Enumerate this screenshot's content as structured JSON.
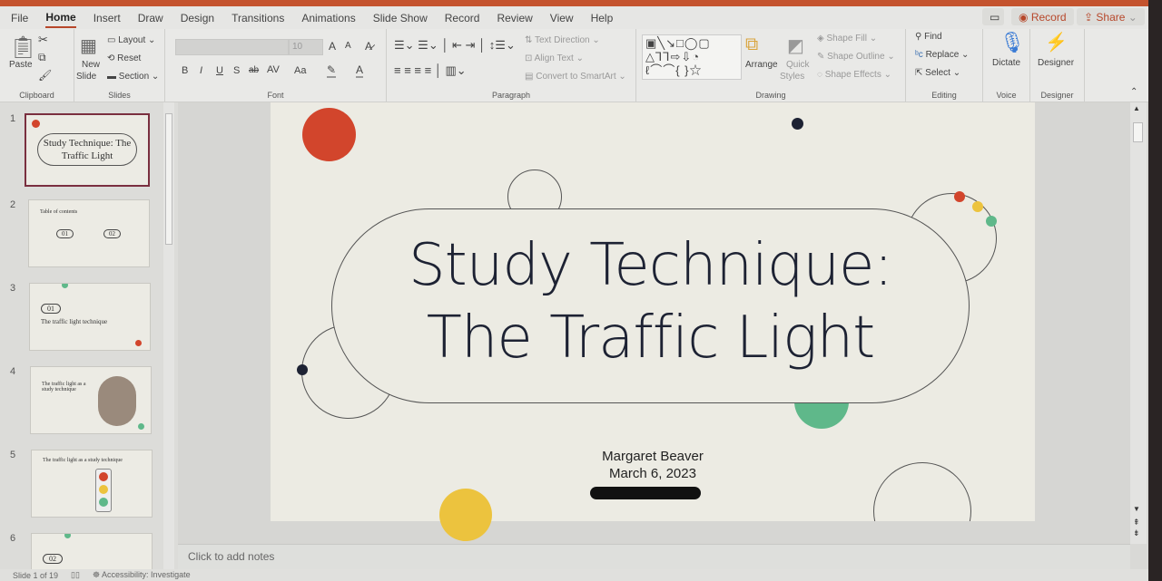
{
  "tabs": [
    "File",
    "Home",
    "Insert",
    "Draw",
    "Design",
    "Transitions",
    "Animations",
    "Slide Show",
    "Record",
    "Review",
    "View",
    "Help"
  ],
  "active_tab": "Home",
  "top_right": {
    "record": "Record",
    "share": "Share"
  },
  "ribbon": {
    "clipboard": {
      "label": "Clipboard",
      "paste": "Paste"
    },
    "slides": {
      "label": "Slides",
      "new_slide": "New",
      "new_slide2": "Slide",
      "layout": "Layout",
      "reset": "Reset",
      "section": "Section"
    },
    "font": {
      "label": "Font",
      "size": "10",
      "bold": "B",
      "italic": "I",
      "underline": "U",
      "shadow": "S",
      "strike": "ab",
      "spacing": "AV",
      "case": "Aa",
      "grow": "A",
      "shrink": "A"
    },
    "paragraph": {
      "label": "Paragraph",
      "text_direction": "Text Direction",
      "align_text": "Align Text",
      "smartart": "Convert to SmartArt"
    },
    "drawing": {
      "label": "Drawing",
      "arrange": "Arrange",
      "quick_styles": "Quick",
      "quick_styles2": "Styles",
      "shape_fill": "Shape Fill",
      "shape_outline": "Shape Outline",
      "shape_effects": "Shape Effects"
    },
    "editing": {
      "label": "Editing",
      "find": "Find",
      "replace": "Replace",
      "select": "Select"
    },
    "voice": {
      "label": "Voice",
      "dictate": "Dictate"
    },
    "designer": {
      "label": "Designer",
      "designer": "Designer"
    }
  },
  "thumbnails": [
    {
      "num": "1",
      "title": "Study Technique: The Traffic Light"
    },
    {
      "num": "2",
      "title": "Table of contents",
      "a": "01",
      "b": "02"
    },
    {
      "num": "3",
      "title": "The traffic light technique",
      "a": "01"
    },
    {
      "num": "4",
      "title": "The traffic light as a study technique"
    },
    {
      "num": "5",
      "title": "The traffic light as a study technique"
    },
    {
      "num": "6",
      "a": "02"
    }
  ],
  "slide": {
    "title_line1": "Study Technique:",
    "title_line2": "The Traffic Light",
    "author": "Margaret Beaver",
    "date": "March 6, 2023"
  },
  "colors": {
    "red": "#d2452c",
    "yellow": "#ecc33e",
    "green": "#5fb88a",
    "navy": "#1d2233"
  },
  "notes_placeholder": "Click to add notes",
  "status": {
    "slide": "Slide 1 of 19",
    "accessibility": "Accessibility: Investigate"
  }
}
